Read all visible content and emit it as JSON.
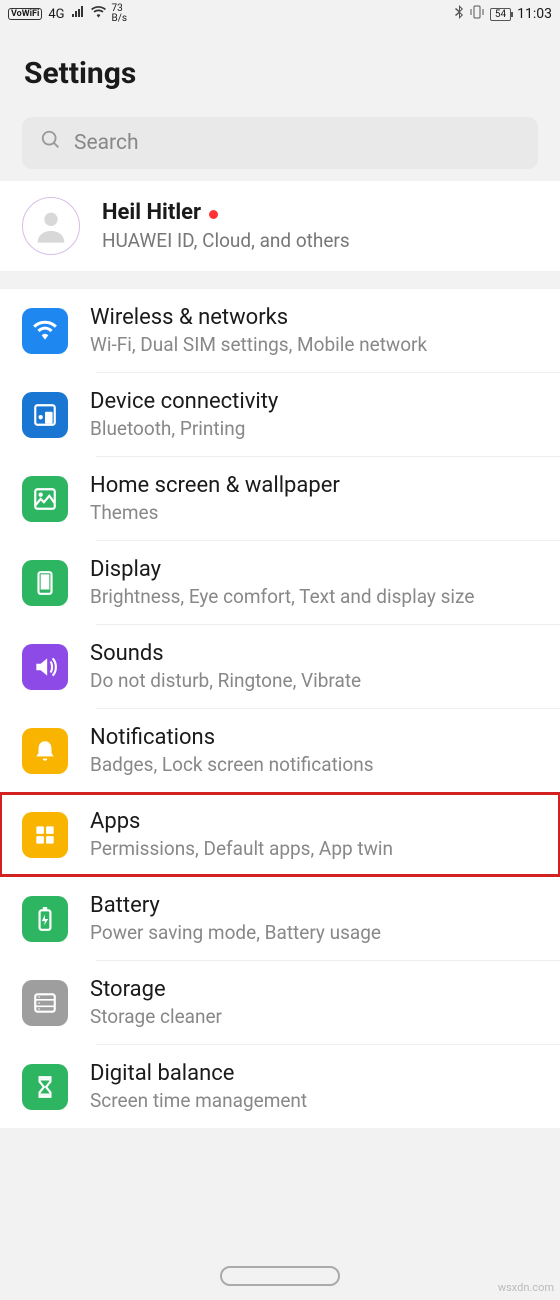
{
  "status": {
    "vowifi": "VoWiFi",
    "net": "4G",
    "data_rate_num": "73",
    "data_rate_unit": "B/s",
    "battery": "54",
    "time": "11:03"
  },
  "title": "Settings",
  "search_placeholder": "Search",
  "account": {
    "name": "Heil Hitler",
    "sub": "HUAWEI ID, Cloud, and others"
  },
  "rows": [
    {
      "icon": "wifi",
      "color": "#1e88f0",
      "title": "Wireless & networks",
      "sub": "Wi-Fi, Dual SIM settings, Mobile network"
    },
    {
      "icon": "devices",
      "color": "#1976d2",
      "title": "Device connectivity",
      "sub": "Bluetooth, Printing"
    },
    {
      "icon": "home",
      "color": "#2eb562",
      "title": "Home screen & wallpaper",
      "sub": "Themes"
    },
    {
      "icon": "display",
      "color": "#2eb562",
      "title": "Display",
      "sub": "Brightness, Eye comfort, Text and display size"
    },
    {
      "icon": "sound",
      "color": "#8e4ae6",
      "title": "Sounds",
      "sub": "Do not disturb, Ringtone, Vibrate"
    },
    {
      "icon": "bell",
      "color": "#f9b400",
      "title": "Notifications",
      "sub": "Badges, Lock screen notifications"
    },
    {
      "icon": "apps",
      "color": "#f9b400",
      "title": "Apps",
      "sub": "Permissions, Default apps, App twin",
      "highlight": true
    },
    {
      "icon": "battery",
      "color": "#2eb562",
      "title": "Battery",
      "sub": "Power saving mode, Battery usage"
    },
    {
      "icon": "storage",
      "color": "#9e9e9e",
      "title": "Storage",
      "sub": "Storage cleaner"
    },
    {
      "icon": "hourglass",
      "color": "#2eb562",
      "title": "Digital balance",
      "sub": "Screen time management"
    }
  ],
  "watermark": "wsxdn.com"
}
